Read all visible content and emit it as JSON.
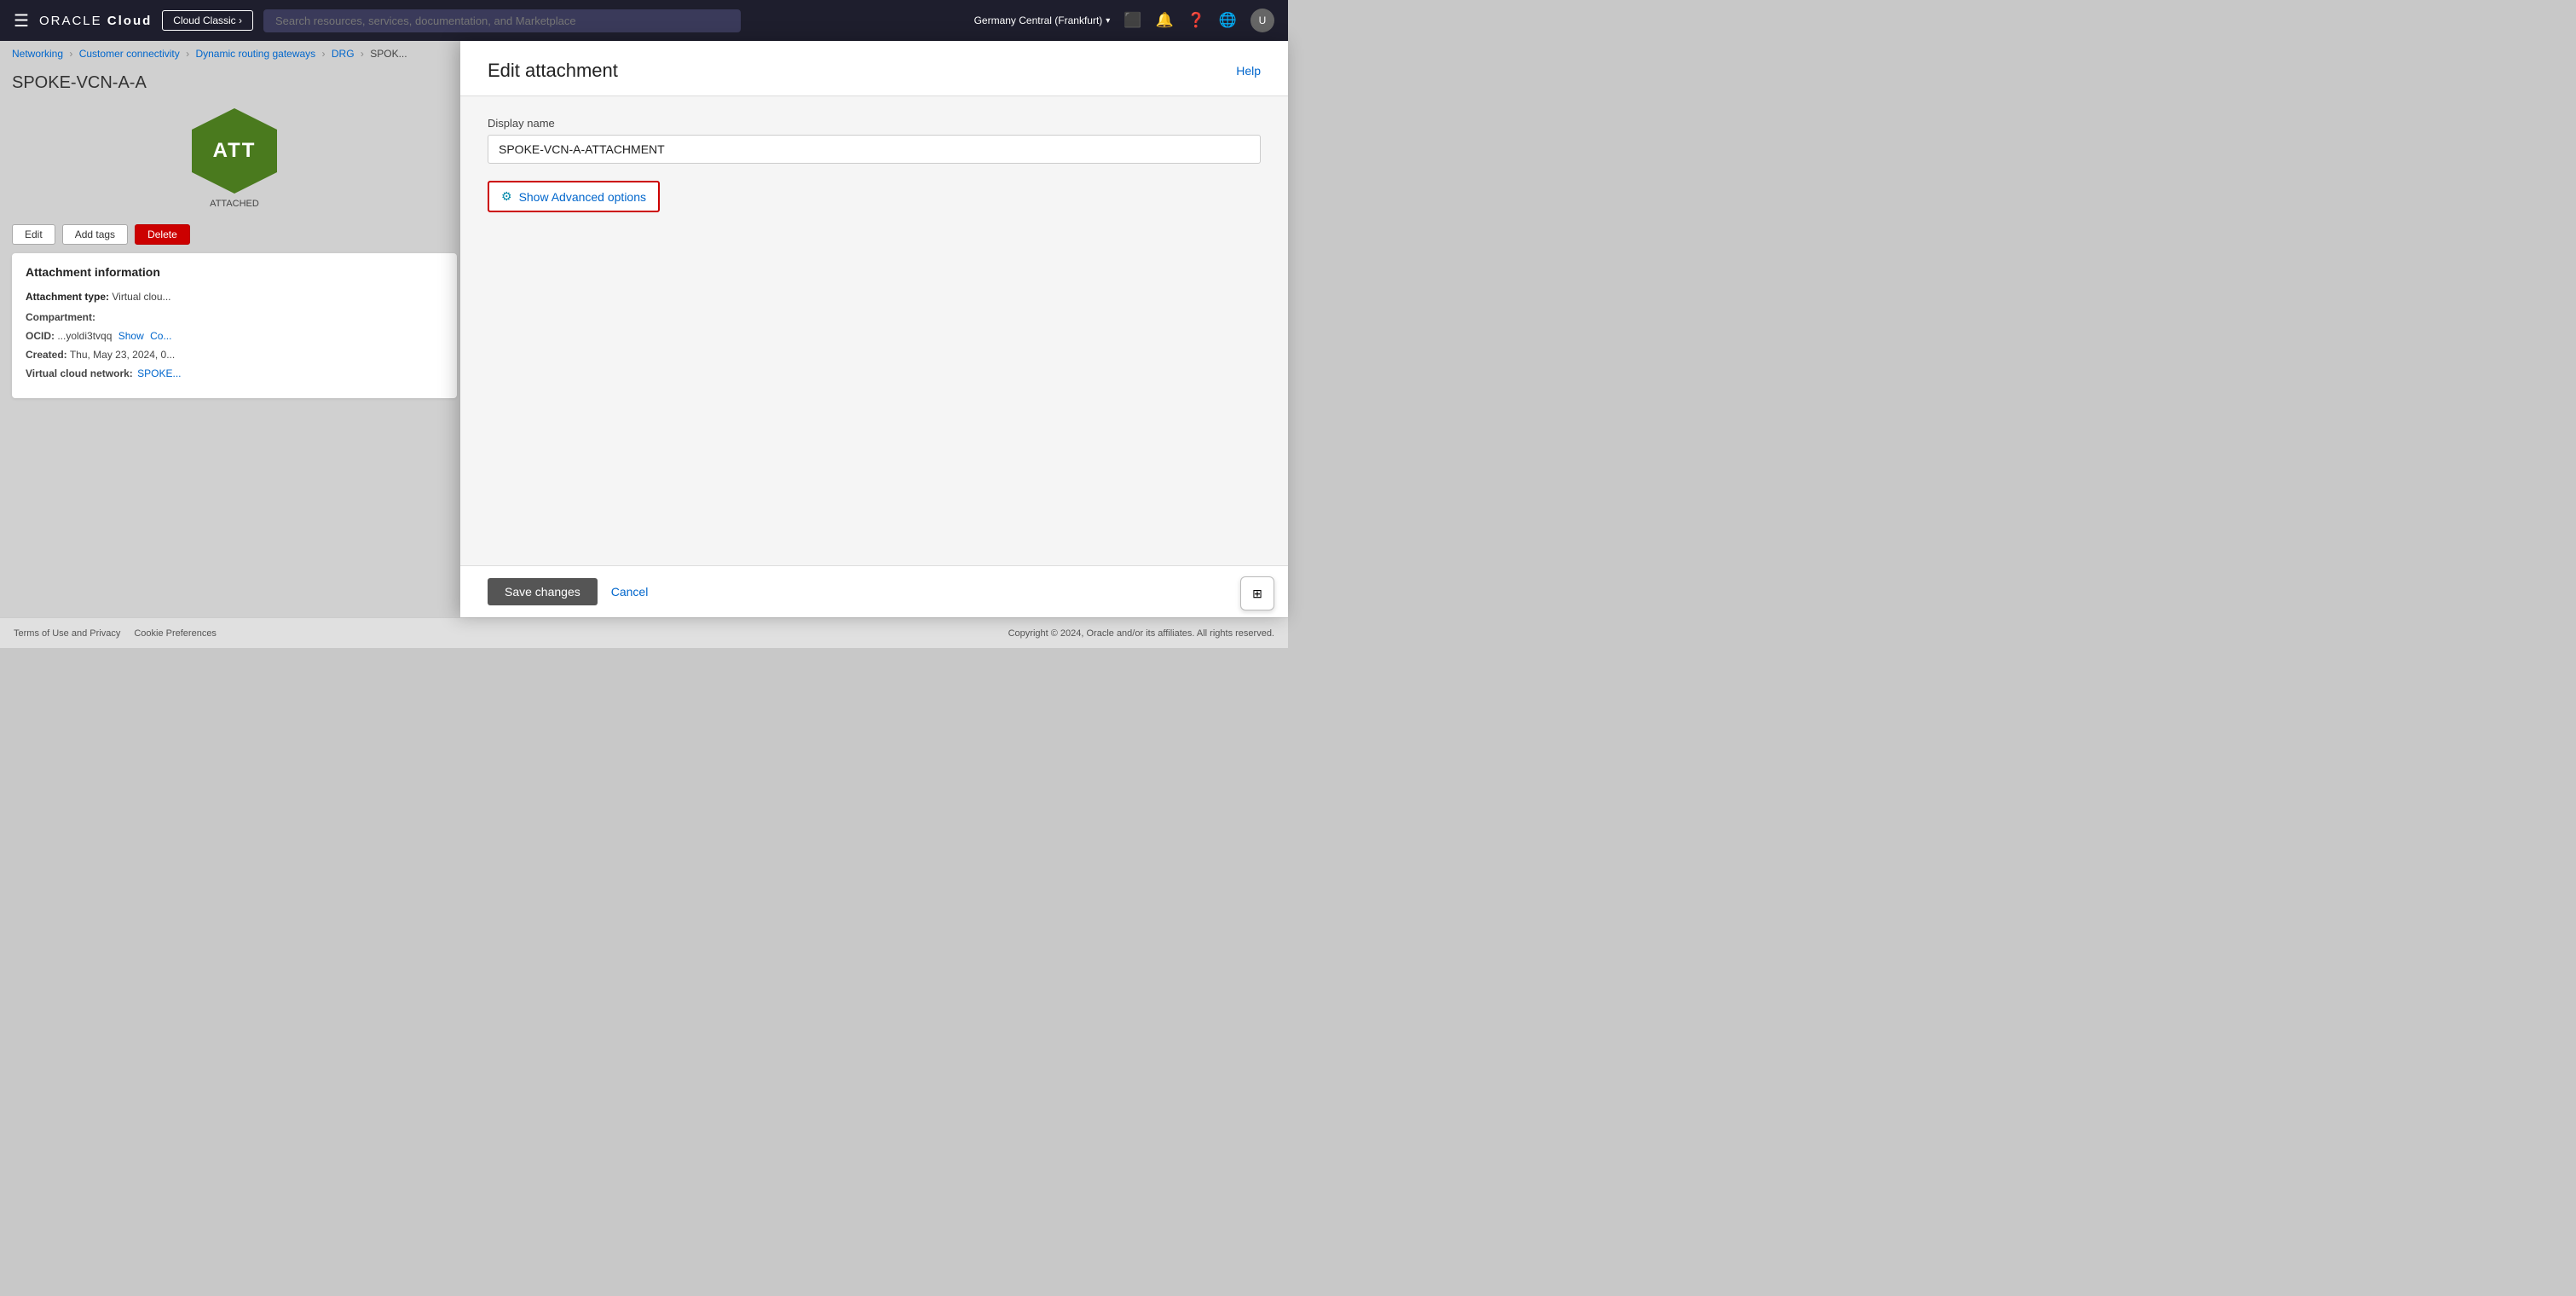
{
  "nav": {
    "hamburger": "≡",
    "logo_oracle": "ORACLE",
    "logo_cloud": "Cloud",
    "classic_btn": "Cloud Classic ›",
    "search_placeholder": "Search resources, services, documentation, and Marketplace",
    "region": "Germany Central (Frankfurt)",
    "help_label": "Help"
  },
  "breadcrumb": {
    "networking": "Networking",
    "customer_connectivity": "Customer connectivity",
    "dynamic_routing_gateways": "Dynamic routing gateways",
    "drg": "DRG",
    "spoke": "SPOK..."
  },
  "resource": {
    "title": "SPOKE-VCN-A-A",
    "hex_letters": "ATT",
    "status": "ATTACHED"
  },
  "action_buttons": {
    "edit": "Edit",
    "add_tags": "Add tags",
    "delete": "Delete"
  },
  "info_panel": {
    "title": "Attachment information",
    "attachment_type_label": "Attachment type:",
    "attachment_type_value": "Virtual clou...",
    "compartment_label": "Compartment:",
    "compartment_value": "",
    "ocid_label": "OCID:",
    "ocid_value": "...yoldi3tvqq",
    "ocid_show": "Show",
    "ocid_copy": "Co...",
    "created_label": "Created:",
    "created_value": "Thu, May 23, 2024, 0...",
    "vcn_label": "Virtual cloud network:",
    "vcn_value": "SPOKE..."
  },
  "edit_dialog": {
    "title": "Edit attachment",
    "help_link": "Help",
    "display_name_label": "Display name",
    "display_name_value": "SPOKE-VCN-A-ATTACHMENT",
    "advanced_options_label": "Show Advanced options",
    "save_label": "Save changes",
    "cancel_label": "Cancel"
  },
  "footer": {
    "terms": "Terms of Use and Privacy",
    "cookies": "Cookie Preferences",
    "copyright": "Copyright © 2024, Oracle and/or its affiliates. All rights reserved."
  }
}
